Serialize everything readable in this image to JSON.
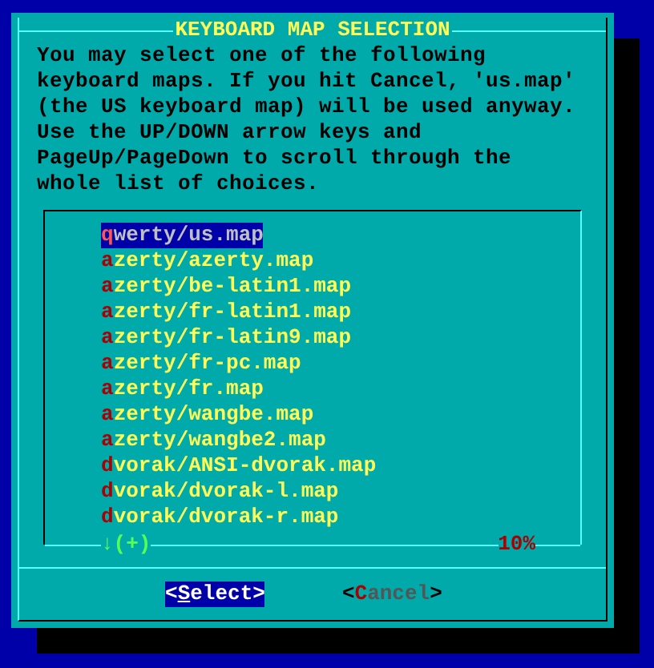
{
  "dialog": {
    "title": "KEYBOARD MAP SELECTION",
    "message": "You may select one of the following keyboard maps. If you hit Cancel, 'us.map' (the US keyboard map) will be used anyway. Use the UP/DOWN arrow keys and PageUp/PageDown to scroll through the whole list of choices."
  },
  "list": {
    "items": [
      {
        "label": "qwerty/us.map",
        "selected": true
      },
      {
        "label": "azerty/azerty.map",
        "selected": false
      },
      {
        "label": "azerty/be-latin1.map",
        "selected": false
      },
      {
        "label": "azerty/fr-latin1.map",
        "selected": false
      },
      {
        "label": "azerty/fr-latin9.map",
        "selected": false
      },
      {
        "label": "azerty/fr-pc.map",
        "selected": false
      },
      {
        "label": "azerty/fr.map",
        "selected": false
      },
      {
        "label": "azerty/wangbe.map",
        "selected": false
      },
      {
        "label": "azerty/wangbe2.map",
        "selected": false
      },
      {
        "label": "dvorak/ANSI-dvorak.map",
        "selected": false
      },
      {
        "label": "dvorak/dvorak-l.map",
        "selected": false
      },
      {
        "label": "dvorak/dvorak-r.map",
        "selected": false
      }
    ],
    "scroll_indicator": "↓(+)",
    "scroll_percent": "10%"
  },
  "buttons": [
    {
      "label": "<Select>",
      "selected": true
    },
    {
      "label": "<Cancel>",
      "selected": false
    }
  ]
}
